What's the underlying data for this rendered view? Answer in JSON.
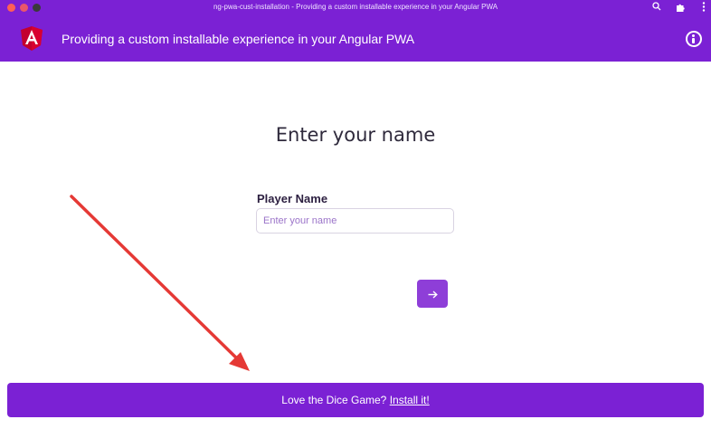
{
  "window": {
    "title": "ng-pwa-cust-installation - Providing a custom installable experience in your Angular PWA",
    "icons": [
      "zoom-icon",
      "extensions-icon",
      "more-vert-icon"
    ]
  },
  "toolbar": {
    "logo_icon": "angular-logo-icon",
    "title": "Providing a custom installable experience in your Angular PWA",
    "info_icon": "info-icon",
    "color": "#7b21d4"
  },
  "main": {
    "heading": "Enter your name",
    "player_label": "Player Name",
    "player_input": {
      "value": "",
      "placeholder": "Enter your name"
    },
    "next_icon": "arrow-right-icon",
    "accent": "#8e3ed8"
  },
  "annotation": {
    "type": "arrow",
    "color": "#e53935"
  },
  "install_banner": {
    "text": "Love the Dice Game?",
    "link_label": "Install it!"
  }
}
